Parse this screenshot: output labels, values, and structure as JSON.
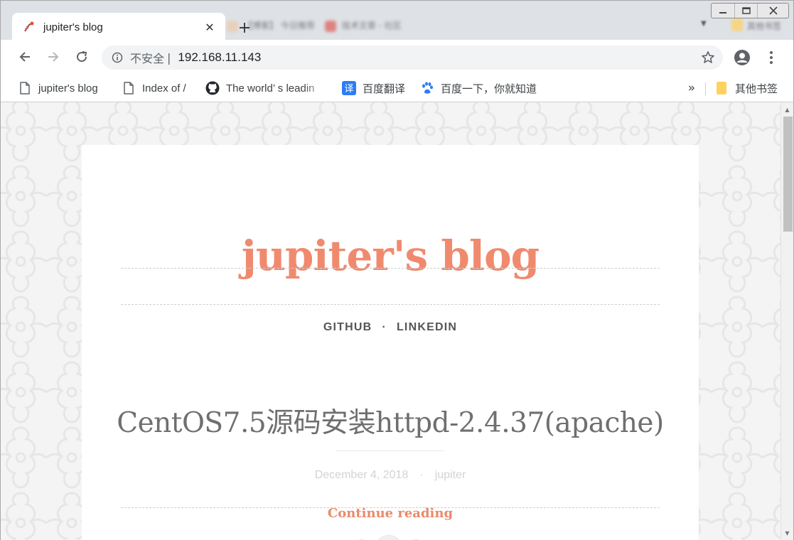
{
  "browser": {
    "tab": {
      "title": "jupiter's blog",
      "close_glyph": "✕"
    },
    "new_tab_glyph": "+",
    "omnibox": {
      "security_label": "不安全",
      "separator": "|",
      "url": "192.168.11.143"
    },
    "bookmarks": [
      {
        "label": "jupiter's blog",
        "icon": "page-icon"
      },
      {
        "label": "Index of /",
        "icon": "page-icon"
      },
      {
        "label": "The world’ s leadin",
        "icon": "github-icon"
      },
      {
        "label": "百度翻译",
        "icon": "baidu-translate-icon"
      },
      {
        "label": "百度一下，你就知道",
        "icon": "baidu-paw-icon"
      }
    ],
    "bookmarks_more": "»",
    "other_bookmarks": "其他书签"
  },
  "page": {
    "blog_title": "jupiter's blog",
    "nav": [
      "GITHUB",
      "LINKEDIN"
    ],
    "nav_separator": "·",
    "post": {
      "title": "CentOS7.5源码安装httpd-2.4.37(apache)",
      "date": "December 4, 2018",
      "meta_separator": "·",
      "author": "jupiter",
      "continue_label": "Continue reading"
    }
  },
  "colors": {
    "accent": "#f08a6e",
    "chrome_bg": "#dee1e6",
    "omnibox_bg": "#f1f3f4",
    "page_bg": "#f4f4f4"
  }
}
